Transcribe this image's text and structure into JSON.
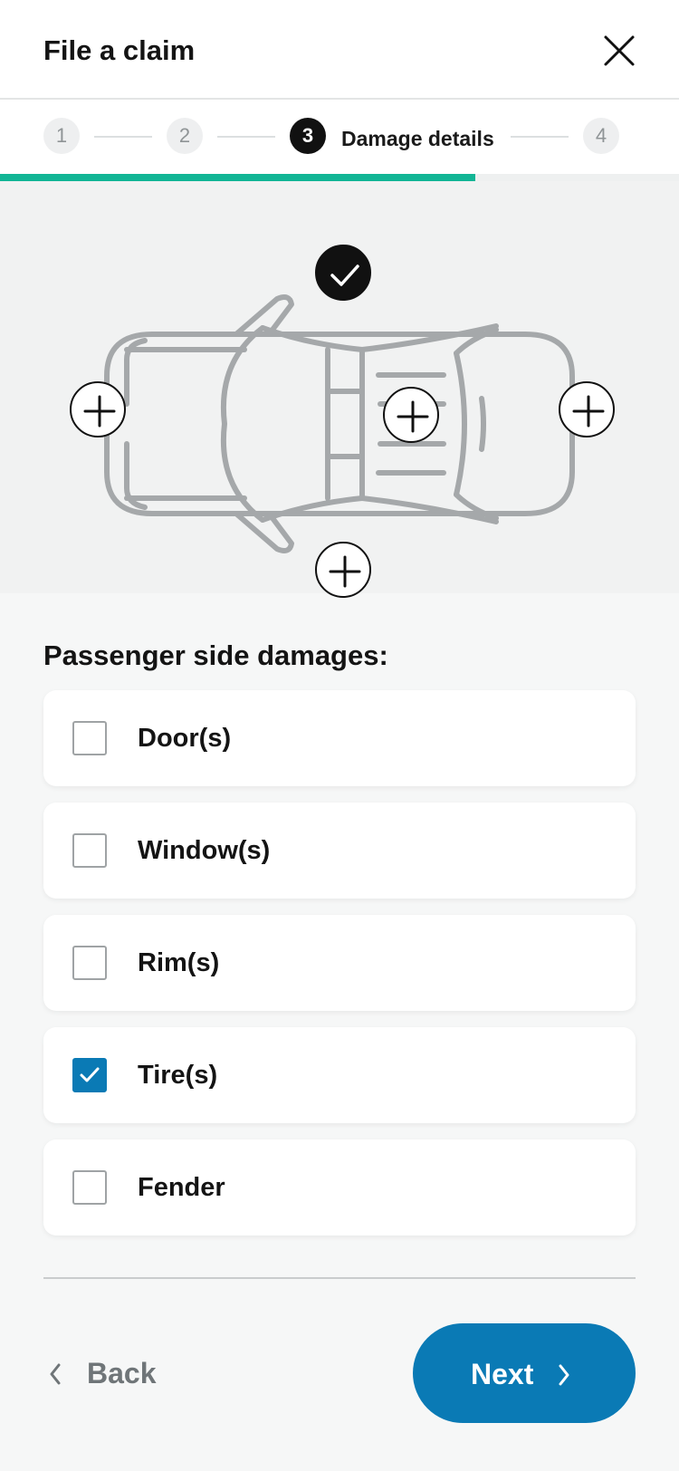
{
  "header": {
    "title": "File a claim",
    "close_icon": "close-icon"
  },
  "stepper": {
    "steps": [
      {
        "number": "1",
        "state": "pending"
      },
      {
        "number": "2",
        "state": "pending"
      },
      {
        "number": "3",
        "state": "active",
        "label": "Damage details"
      },
      {
        "number": "4",
        "state": "pending"
      }
    ],
    "progress_fraction": 0.7,
    "progress_color": "#12b595"
  },
  "diagram": {
    "zones": [
      {
        "id": "roof",
        "state": "selected",
        "icon": "check-icon"
      },
      {
        "id": "front",
        "state": "add",
        "icon": "plus-icon"
      },
      {
        "id": "cabin",
        "state": "add",
        "icon": "plus-icon"
      },
      {
        "id": "rear",
        "state": "add",
        "icon": "plus-icon"
      },
      {
        "id": "passenger-side",
        "state": "add",
        "icon": "plus-icon"
      }
    ]
  },
  "section": {
    "title": "Passenger side damages:"
  },
  "options": [
    {
      "label": "Door(s)",
      "checked": false
    },
    {
      "label": "Window(s)",
      "checked": false
    },
    {
      "label": "Rim(s)",
      "checked": false
    },
    {
      "label": "Tire(s)",
      "checked": true
    },
    {
      "label": "Fender",
      "checked": false
    }
  ],
  "footer": {
    "back_label": "Back",
    "next_label": "Next",
    "accent_color": "#0a7ab5"
  }
}
